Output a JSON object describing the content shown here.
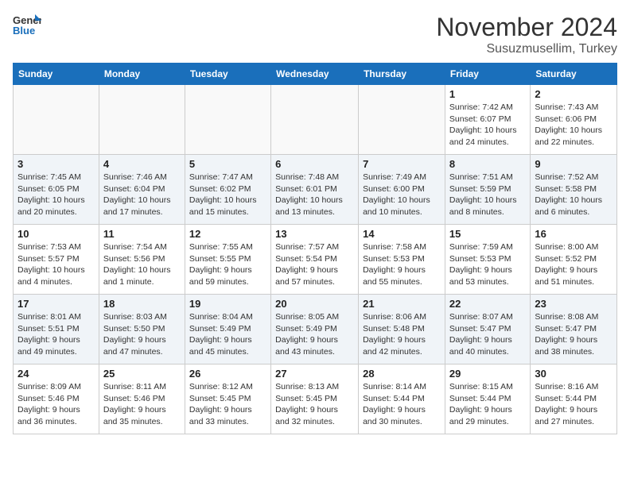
{
  "header": {
    "logo_general": "General",
    "logo_blue": "Blue",
    "month_title": "November 2024",
    "location": "Susuzmusellim, Turkey"
  },
  "weekdays": [
    "Sunday",
    "Monday",
    "Tuesday",
    "Wednesday",
    "Thursday",
    "Friday",
    "Saturday"
  ],
  "weeks": [
    [
      {
        "day": "",
        "detail": ""
      },
      {
        "day": "",
        "detail": ""
      },
      {
        "day": "",
        "detail": ""
      },
      {
        "day": "",
        "detail": ""
      },
      {
        "day": "",
        "detail": ""
      },
      {
        "day": "1",
        "detail": "Sunrise: 7:42 AM\nSunset: 6:07 PM\nDaylight: 10 hours\nand 24 minutes."
      },
      {
        "day": "2",
        "detail": "Sunrise: 7:43 AM\nSunset: 6:06 PM\nDaylight: 10 hours\nand 22 minutes."
      }
    ],
    [
      {
        "day": "3",
        "detail": "Sunrise: 7:45 AM\nSunset: 6:05 PM\nDaylight: 10 hours\nand 20 minutes."
      },
      {
        "day": "4",
        "detail": "Sunrise: 7:46 AM\nSunset: 6:04 PM\nDaylight: 10 hours\nand 17 minutes."
      },
      {
        "day": "5",
        "detail": "Sunrise: 7:47 AM\nSunset: 6:02 PM\nDaylight: 10 hours\nand 15 minutes."
      },
      {
        "day": "6",
        "detail": "Sunrise: 7:48 AM\nSunset: 6:01 PM\nDaylight: 10 hours\nand 13 minutes."
      },
      {
        "day": "7",
        "detail": "Sunrise: 7:49 AM\nSunset: 6:00 PM\nDaylight: 10 hours\nand 10 minutes."
      },
      {
        "day": "8",
        "detail": "Sunrise: 7:51 AM\nSunset: 5:59 PM\nDaylight: 10 hours\nand 8 minutes."
      },
      {
        "day": "9",
        "detail": "Sunrise: 7:52 AM\nSunset: 5:58 PM\nDaylight: 10 hours\nand 6 minutes."
      }
    ],
    [
      {
        "day": "10",
        "detail": "Sunrise: 7:53 AM\nSunset: 5:57 PM\nDaylight: 10 hours\nand 4 minutes."
      },
      {
        "day": "11",
        "detail": "Sunrise: 7:54 AM\nSunset: 5:56 PM\nDaylight: 10 hours\nand 1 minute."
      },
      {
        "day": "12",
        "detail": "Sunrise: 7:55 AM\nSunset: 5:55 PM\nDaylight: 9 hours\nand 59 minutes."
      },
      {
        "day": "13",
        "detail": "Sunrise: 7:57 AM\nSunset: 5:54 PM\nDaylight: 9 hours\nand 57 minutes."
      },
      {
        "day": "14",
        "detail": "Sunrise: 7:58 AM\nSunset: 5:53 PM\nDaylight: 9 hours\nand 55 minutes."
      },
      {
        "day": "15",
        "detail": "Sunrise: 7:59 AM\nSunset: 5:53 PM\nDaylight: 9 hours\nand 53 minutes."
      },
      {
        "day": "16",
        "detail": "Sunrise: 8:00 AM\nSunset: 5:52 PM\nDaylight: 9 hours\nand 51 minutes."
      }
    ],
    [
      {
        "day": "17",
        "detail": "Sunrise: 8:01 AM\nSunset: 5:51 PM\nDaylight: 9 hours\nand 49 minutes."
      },
      {
        "day": "18",
        "detail": "Sunrise: 8:03 AM\nSunset: 5:50 PM\nDaylight: 9 hours\nand 47 minutes."
      },
      {
        "day": "19",
        "detail": "Sunrise: 8:04 AM\nSunset: 5:49 PM\nDaylight: 9 hours\nand 45 minutes."
      },
      {
        "day": "20",
        "detail": "Sunrise: 8:05 AM\nSunset: 5:49 PM\nDaylight: 9 hours\nand 43 minutes."
      },
      {
        "day": "21",
        "detail": "Sunrise: 8:06 AM\nSunset: 5:48 PM\nDaylight: 9 hours\nand 42 minutes."
      },
      {
        "day": "22",
        "detail": "Sunrise: 8:07 AM\nSunset: 5:47 PM\nDaylight: 9 hours\nand 40 minutes."
      },
      {
        "day": "23",
        "detail": "Sunrise: 8:08 AM\nSunset: 5:47 PM\nDaylight: 9 hours\nand 38 minutes."
      }
    ],
    [
      {
        "day": "24",
        "detail": "Sunrise: 8:09 AM\nSunset: 5:46 PM\nDaylight: 9 hours\nand 36 minutes."
      },
      {
        "day": "25",
        "detail": "Sunrise: 8:11 AM\nSunset: 5:46 PM\nDaylight: 9 hours\nand 35 minutes."
      },
      {
        "day": "26",
        "detail": "Sunrise: 8:12 AM\nSunset: 5:45 PM\nDaylight: 9 hours\nand 33 minutes."
      },
      {
        "day": "27",
        "detail": "Sunrise: 8:13 AM\nSunset: 5:45 PM\nDaylight: 9 hours\nand 32 minutes."
      },
      {
        "day": "28",
        "detail": "Sunrise: 8:14 AM\nSunset: 5:44 PM\nDaylight: 9 hours\nand 30 minutes."
      },
      {
        "day": "29",
        "detail": "Sunrise: 8:15 AM\nSunset: 5:44 PM\nDaylight: 9 hours\nand 29 minutes."
      },
      {
        "day": "30",
        "detail": "Sunrise: 8:16 AM\nSunset: 5:44 PM\nDaylight: 9 hours\nand 27 minutes."
      }
    ]
  ]
}
